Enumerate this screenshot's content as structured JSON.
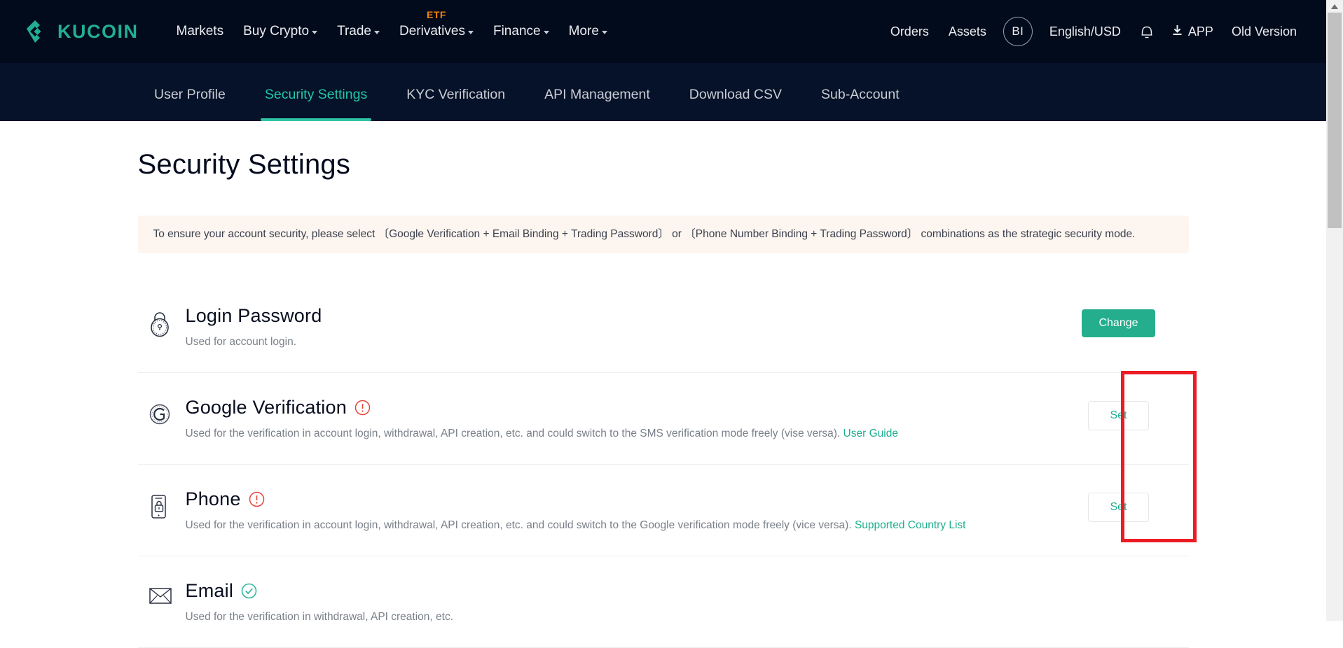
{
  "brand": {
    "name": "KUCOIN",
    "accent": "#23AF91",
    "logo_icon": "kucoin-logo-icon"
  },
  "header": {
    "nav": [
      {
        "label": "Markets",
        "caret": false,
        "badge": null
      },
      {
        "label": "Buy Crypto",
        "caret": true,
        "badge": null
      },
      {
        "label": "Trade",
        "caret": true,
        "badge": null
      },
      {
        "label": "Derivatives",
        "caret": true,
        "badge": "ETF"
      },
      {
        "label": "Finance",
        "caret": true,
        "badge": null
      },
      {
        "label": "More",
        "caret": true,
        "badge": null
      }
    ],
    "right": {
      "orders": "Orders",
      "assets": "Assets",
      "avatar_initials": "BI",
      "language": "English/USD",
      "bell_icon": "notification-bell-icon",
      "download_icon": "download-icon",
      "app": "APP",
      "old_version": "Old Version"
    }
  },
  "subnav": {
    "tabs": [
      {
        "label": "User Profile",
        "active": false
      },
      {
        "label": "Security Settings",
        "active": true
      },
      {
        "label": "KYC Verification",
        "active": false
      },
      {
        "label": "API Management",
        "active": false
      },
      {
        "label": "Download CSV",
        "active": false
      },
      {
        "label": "Sub-Account",
        "active": false
      }
    ]
  },
  "main": {
    "title": "Security Settings",
    "notice": "To ensure your account security, please select 〔Google Verification + Email Binding + Trading Password〕 or 〔Phone Number Binding + Trading Password〕 combinations as the strategic security mode.",
    "rows": [
      {
        "icon": "padlock-icon",
        "title": "Login Password",
        "status": "none",
        "desc": "Used for account login.",
        "link": "",
        "action_label": "Change",
        "action_style": "primary"
      },
      {
        "icon": "google-g-icon",
        "title": "Google Verification",
        "status": "warning",
        "desc": "Used for the verification in account login, withdrawal, API creation, etc. and could switch to the SMS verification mode freely (vise versa). ",
        "link": "User Guide",
        "action_label": "Set",
        "action_style": "ghost"
      },
      {
        "icon": "phone-lock-icon",
        "title": "Phone",
        "status": "warning",
        "desc": "Used for the verification in account login, withdrawal, API creation, etc. and could switch to the Google verification mode freely (vice versa). ",
        "link": "Supported Country List",
        "action_label": "Set",
        "action_style": "ghost"
      },
      {
        "icon": "envelope-icon",
        "title": "Email",
        "status": "verified",
        "desc": "Used for the verification in withdrawal, API creation, etc.",
        "link": "",
        "action_label": "",
        "action_style": "none"
      }
    ]
  },
  "annotation": {
    "color": "#ED1C24",
    "shape": "rectangle-highlight"
  },
  "colors": {
    "header_bg": "#020B1C",
    "subnav_bg": "#061229",
    "accent_teal": "#23AF91",
    "warning_red": "#E8453C",
    "etf_orange": "#F0820E",
    "notice_bg": "#FDF6F0"
  }
}
